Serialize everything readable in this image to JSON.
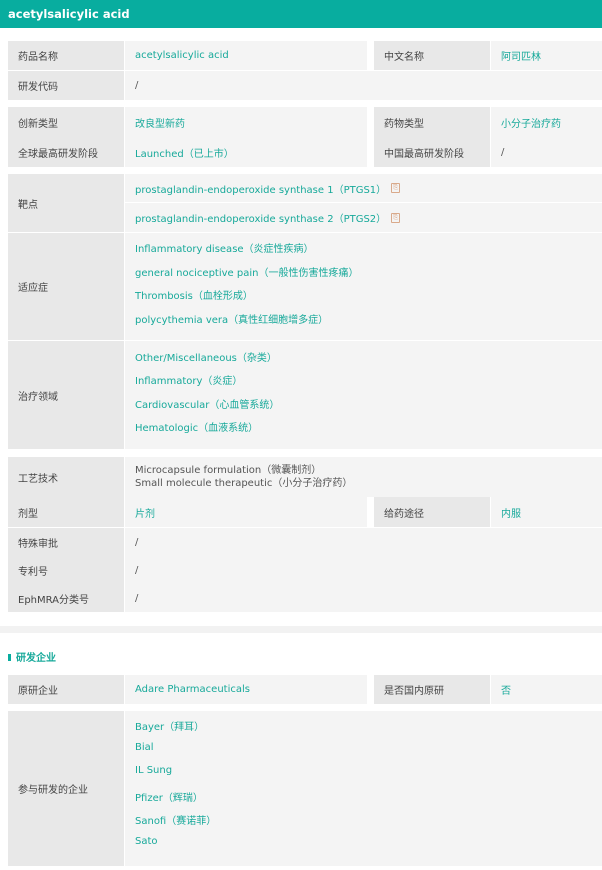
{
  "header": {
    "title": "acetylsalicylic acid"
  },
  "basic": {
    "drug_name_label": "药品名称",
    "drug_name": "acetylsalicylic acid",
    "cn_name_label": "中文名称",
    "cn_name": "阿司匹林",
    "code_label": "研发代码",
    "code": "/",
    "innovation_label": "创新类型",
    "innovation": "改良型新药",
    "drug_type_label": "药物类型",
    "drug_type": "小分子治疗药",
    "global_stage_label": "全球最高研发阶段",
    "global_stage": "Launched（已上市）",
    "cn_stage_label": "中国最高研发阶段",
    "cn_stage": "/",
    "targets_label": "靶点",
    "targets": [
      "prostaglandin-endoperoxide synthase 1（PTGS1）",
      "prostaglandin-endoperoxide synthase 2（PTGS2）"
    ],
    "indications_label": "适应症",
    "indications": [
      "Inflammatory disease（炎症性疾病）",
      "general nociceptive pain（一般性伤害性疼痛）",
      "Thrombosis（血栓形成）",
      "polycythemia vera（真性红细胞增多症）"
    ],
    "areas_label": "治疗领域",
    "areas": [
      "Other/Miscellaneous（杂类）",
      "Inflammatory（炎症）",
      "Cardiovascular（心血管系统）",
      "Hematologic（血液系统）"
    ],
    "tech_label": "工艺技术",
    "tech": [
      "Microcapsule formulation（微囊制剂）",
      "Small molecule therapeutic（小分子治疗药）"
    ],
    "dosage_label": "剂型",
    "dosage": "片剂",
    "route_label": "给药途径",
    "route": "内服",
    "special_label": "特殊审批",
    "special": "/",
    "patent_label": "专利号",
    "patent": "/",
    "ephmra_label": "EphMRA分类号",
    "ephmra": "/"
  },
  "companies": {
    "section_title": "研发企业",
    "originator_label": "原研企业",
    "originator": "Adare Pharmaceuticals",
    "domestic_label": "是否国内原研",
    "domestic": "否",
    "participants_label": "参与研发的企业",
    "participants": [
      "Bayer（拜耳）",
      "Bial",
      "IL Sung",
      "Pfizer（辉瑞）",
      "Sanofi（赛诺菲）",
      "Sato"
    ]
  }
}
